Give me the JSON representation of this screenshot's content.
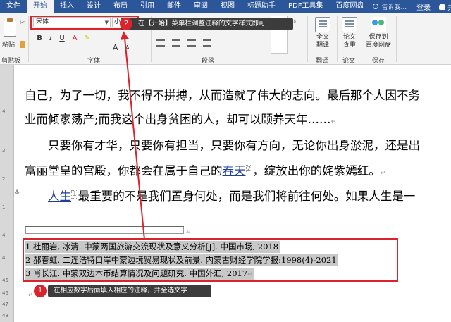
{
  "menubar": {
    "tabs": [
      "文件",
      "开始",
      "插入",
      "设计",
      "布局",
      "引用",
      "邮件",
      "审阅",
      "视图",
      "标题助手",
      "PDF工具集",
      "百度网盘"
    ],
    "active_tab": "开始",
    "tell_me": "告诉我...",
    "login": "登录",
    "share": "共享"
  },
  "ribbon": {
    "clipboard": {
      "paste_label": "粘贴",
      "group_label": "剪贴板"
    },
    "font": {
      "font_name": "宋体",
      "font_size": "小五",
      "bold": "B",
      "italic": "I",
      "underline": "U",
      "group_label": "字体"
    },
    "paragraph": {
      "group_label": "段落"
    },
    "translate": {
      "full_text_label": "全文\n翻译",
      "group_label": "翻译"
    },
    "paper": {
      "check_label": "论文\n查重",
      "group_label": "论文"
    },
    "save": {
      "baidu_label": "保存到\n百度网盘",
      "group_label": "保存"
    }
  },
  "annotations": {
    "step2": {
      "number": "2",
      "text": "在【开始】菜单栏调整注释的文字样式即可"
    },
    "step1": {
      "number": "1",
      "text": "在相应数字后面填入相应的注释，并全选文字"
    }
  },
  "document": {
    "lines": [
      {
        "text": "自己，为了一切，我不得不拼搏，从而造就了伟大的志向。最后那个人因不务"
      },
      {
        "text": "业而倾家荡产;而我这个出身贫困的人，却可以颐养天年……"
      },
      {
        "text": "只要你有才华，只要你有担当，只要你有方向，无论你出身淤泥，还是出"
      },
      {
        "pre": "富丽堂皇的宫殿，你都会在属于自己的",
        "link": "春天",
        "ref": "2",
        "post": "，绽放出你的姹紫嫣红。"
      },
      {
        "link": "人生",
        "ref": "1",
        "post": "最重要的不是我们置身何处，而是我们将前往何处。如果人生是一"
      }
    ],
    "footnotes": [
      {
        "text": "1 杜丽岩, 冰清. 中蒙两国旅游交流现状及意义分析[J]. 中国市场, 2018"
      },
      {
        "text": "2 郝春虹. 二连浩特口岸中蒙边境贸易现状及前景. 内蒙古财经学院学报:1998(4)-2021"
      },
      {
        "text": "3 肖长江. 中蒙双边本币结算情况及问题研究. 中国外汇, 2017"
      }
    ]
  },
  "ruler": {
    "numbers": [
      "4",
      "3",
      "2",
      "1",
      "4",
      "4",
      "45",
      "46",
      "47",
      "48"
    ]
  },
  "colors": {
    "ribbon_blue": "#2b579a",
    "annotation_red": "#d9232d",
    "callout_dark": "#3c3c3c",
    "link_blue": "#1f3f99"
  }
}
